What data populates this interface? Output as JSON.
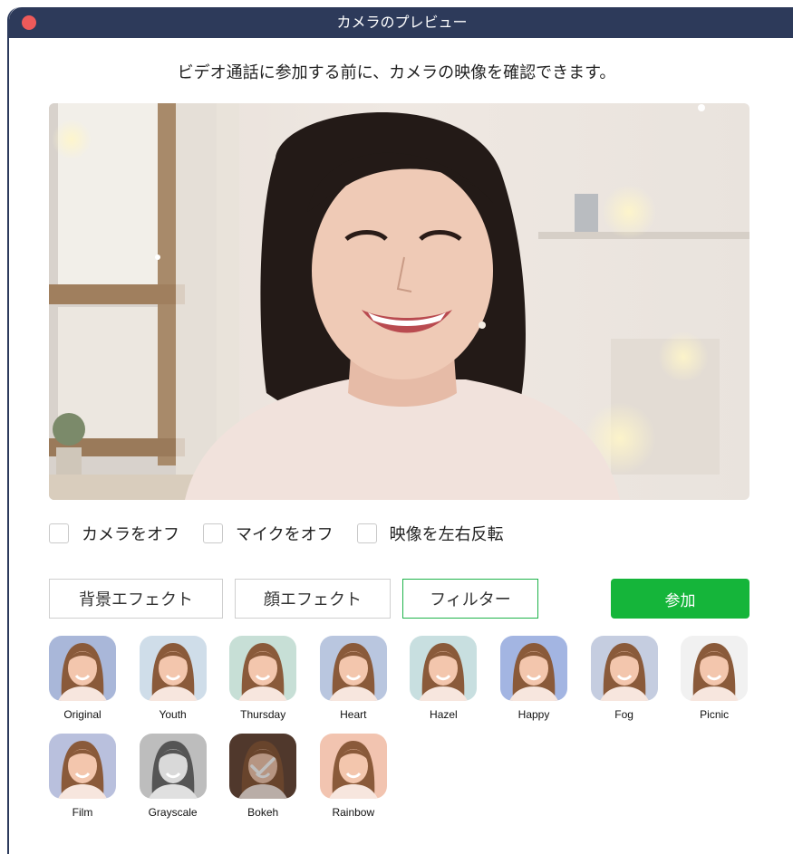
{
  "window": {
    "title": "カメラのプレビュー"
  },
  "subtitle": "ビデオ通話に参加する前に、カメラの映像を確認できます。",
  "options": [
    {
      "label": "カメラをオフ",
      "checked": false
    },
    {
      "label": "マイクをオフ",
      "checked": false
    },
    {
      "label": "映像を左右反転",
      "checked": false
    }
  ],
  "tabs": [
    {
      "label": "背景エフェクト",
      "active": false
    },
    {
      "label": "顔エフェクト",
      "active": false
    },
    {
      "label": "フィルター",
      "active": true
    }
  ],
  "join_button": "参加",
  "filters": [
    {
      "label": "Original",
      "bg": "#a9b7d9",
      "selected": false
    },
    {
      "label": "Youth",
      "bg": "#cfdde9",
      "selected": false
    },
    {
      "label": "Thursday",
      "bg": "#c7dfd6",
      "selected": false
    },
    {
      "label": "Heart",
      "bg": "#b9c6df",
      "selected": false
    },
    {
      "label": "Hazel",
      "bg": "#c8dfe0",
      "selected": false
    },
    {
      "label": "Happy",
      "bg": "#a3b5e2",
      "selected": false
    },
    {
      "label": "Fog",
      "bg": "#c5cde0",
      "selected": false
    },
    {
      "label": "Picnic",
      "bg": "#f1f1f1",
      "selected": false
    },
    {
      "label": "Film",
      "bg": "#b9c0dd",
      "selected": false
    },
    {
      "label": "Grayscale",
      "bg": "#bdbdbd",
      "selected": false
    },
    {
      "label": "Bokeh",
      "bg": "#6a4a3a",
      "selected": true
    },
    {
      "label": "Rainbow",
      "bg": "#f2c4b0",
      "selected": false
    }
  ],
  "colors": {
    "titlebar": "#2d3a5a",
    "accent": "#15b53a",
    "close": "#ee5a5a"
  }
}
